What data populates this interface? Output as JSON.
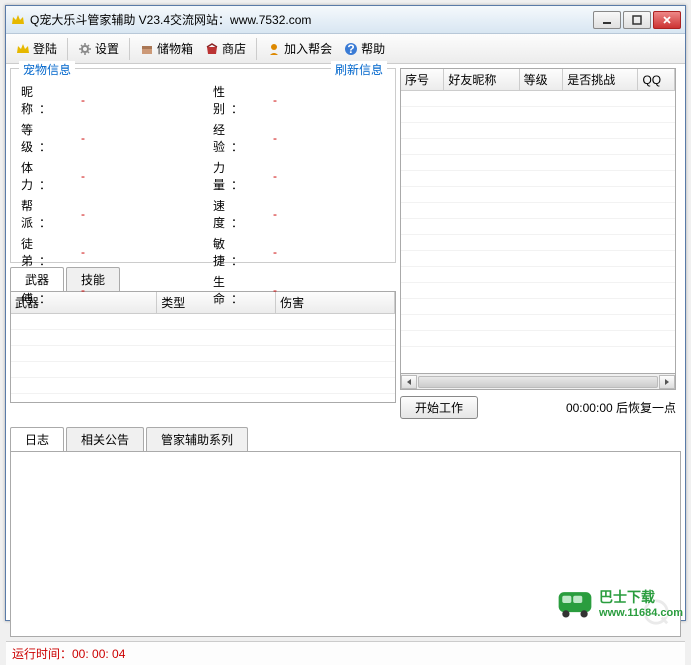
{
  "window": {
    "title": "Q宠大乐斗管家辅助 V23.4交流网站：www.7532.com"
  },
  "toolbar": {
    "login": "登陆",
    "settings": "设置",
    "storage": "储物箱",
    "shop": "商店",
    "join": "加入帮会",
    "help": "帮助"
  },
  "petinfo": {
    "title": "宠物信息",
    "refresh": "刷新信息",
    "labels": {
      "nickname": "昵 称：",
      "gender": "性 别：",
      "level": "等 级：",
      "exp": "经 验：",
      "stamina": "体 力：",
      "power": "力 量：",
      "faction": "帮 派：",
      "speed": "速 度：",
      "apprentice": "徒 弟：",
      "agility": "敏 捷：",
      "master": "师 傅：",
      "life": "生 命："
    },
    "values": {
      "nickname": "-",
      "gender": "-",
      "level": "-",
      "exp": "-",
      "stamina": "-",
      "power": "-",
      "faction": "-",
      "speed": "-",
      "apprentice": "-",
      "agility": "-",
      "master": "-",
      "life": "-"
    }
  },
  "equip_tabs": {
    "weapon": "武器",
    "skill": "技能"
  },
  "weapon_table": {
    "headers": {
      "name": "武器",
      "type": "类型",
      "damage": "伤害"
    }
  },
  "friends_table": {
    "headers": {
      "idx": "序号",
      "nick": "好友昵称",
      "level": "等级",
      "challenge": "是否挑战",
      "qq": "QQ"
    }
  },
  "action": {
    "start": "开始工作",
    "countdown": "00:00:00 后恢复一点"
  },
  "log_tabs": {
    "log": "日志",
    "notice": "相关公告",
    "series": "管家辅助系列"
  },
  "status": {
    "runtime": "运行时间：00: 00: 04"
  },
  "site": {
    "name": "巴士下载",
    "url": "www.11684.com"
  }
}
